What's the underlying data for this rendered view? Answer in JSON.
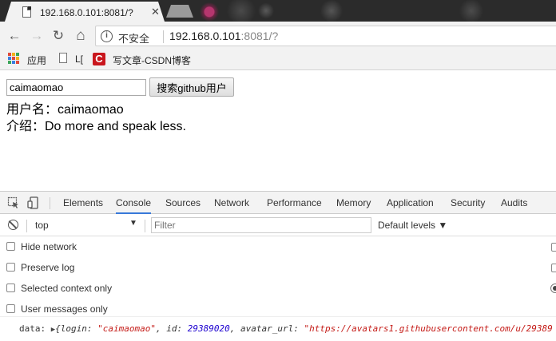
{
  "browser": {
    "tab": {
      "title": "192.168.0.101:8081/?",
      "close_glyph": "✕"
    },
    "nav": {
      "back": "←",
      "forward": "→",
      "reload": "↻",
      "home": "⌂"
    },
    "address": {
      "security_label": "不安全",
      "host": "192.168.0.101",
      "path": ":8081/?"
    },
    "bookmarks": [
      {
        "label": "应用",
        "icon": "apps-grid-icon"
      },
      {
        "label": "L[",
        "icon": "page-icon"
      },
      {
        "label": "写文章-CSDN博客",
        "icon": "csdn-icon",
        "icon_glyph": "C"
      }
    ]
  },
  "page": {
    "search_value": "caimaomao",
    "search_button_label": "搜索github用户",
    "username_line": "用户名：caimaomao",
    "intro_line": "介绍：Do more and speak less."
  },
  "devtools": {
    "tabs": [
      "Elements",
      "Console",
      "Sources",
      "Network",
      "Performance",
      "Memory",
      "Application",
      "Security",
      "Audits"
    ],
    "active_tab": "Console",
    "context": "top",
    "filter_placeholder": "Filter",
    "levels_label": "Default levels ▼",
    "options": [
      "Hide network",
      "Preserve log",
      "Selected context only",
      "User messages only"
    ],
    "log": {
      "label": "data:",
      "open_brace": "{",
      "k_login": "login:",
      "v_login": "\"caimaomao\"",
      "comma": ",",
      "k_id": "id:",
      "v_id": "29389020",
      "k_avatar": "avatar_url:",
      "v_avatar": "\"https://avatars1.githubusercontent.com/u/29389"
    }
  },
  "colors": {
    "accent_tab": "#3879d9",
    "csdn_red": "#c9161d",
    "string": "#c41a16",
    "number": "#1c00cf"
  }
}
